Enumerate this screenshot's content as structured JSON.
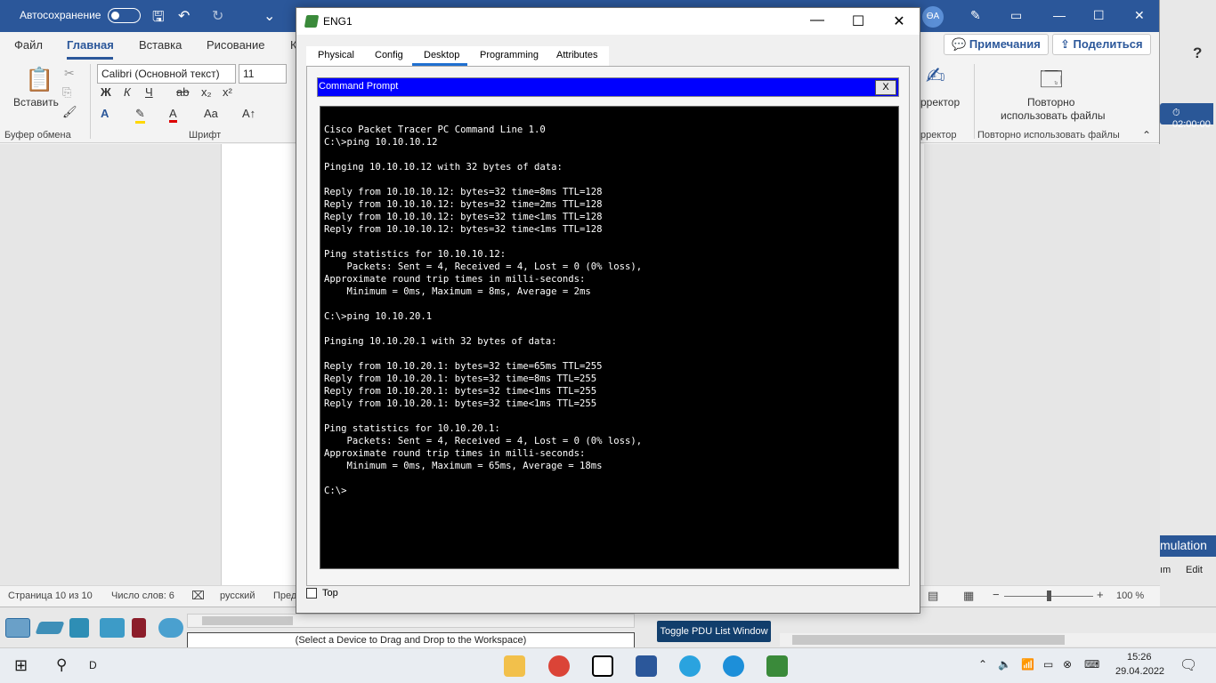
{
  "word": {
    "title_bar": {
      "autosave_label": "Автосохранение",
      "user_initials": "ӨА"
    },
    "menu": [
      "Файл",
      "Главная",
      "Вставка",
      "Рисование",
      "К"
    ],
    "notes_button": "Примечания",
    "share_button": "Поделиться",
    "help": "?",
    "ribbon": {
      "paste_label": "Вставить",
      "clipboard_group": "Буфер обмена",
      "font_name": "Calibri (Основной текст)",
      "font_size": "11",
      "bold": "Ж",
      "italic": "К",
      "underline": "Ч",
      "strike": "ab",
      "subscript": "x₂",
      "superscript": "x²",
      "font_group": "Шрифт",
      "case": "Aa",
      "grow": "A↑",
      "editor_label": "рректор",
      "editor_group": "рректор",
      "reuse_label_1": "Повторно",
      "reuse_label_2": "использовать файлы",
      "reuse_group": "Повторно использовать файлы"
    },
    "status": {
      "page": "Страница 10 из 10",
      "words": "Число слов: 6",
      "language": "русский",
      "cut": "Пред",
      "zoom": "100 %",
      "zoom_minus": "−",
      "zoom_plus": "+"
    }
  },
  "pt": {
    "timer": "02:00:00",
    "simulation": "mulation",
    "um": "ım",
    "edit": "Edit",
    "device_hint": "(Select a Device to Drag and Drop to the Workspace)",
    "toggle_pdu": "Toggle PDU List Window"
  },
  "eng1": {
    "title": "ENG1",
    "tabs": [
      "Physical",
      "Config",
      "Desktop",
      "Programming",
      "Attributes"
    ],
    "active_tab": "Desktop",
    "cmd_title": "Command Prompt",
    "cmd_close": "X",
    "top_label": "Top",
    "terminal_lines": [
      "Cisco Packet Tracer PC Command Line 1.0",
      "C:\\>ping 10.10.10.12",
      "",
      "Pinging 10.10.10.12 with 32 bytes of data:",
      "",
      "Reply from 10.10.10.12: bytes=32 time=8ms TTL=128",
      "Reply from 10.10.10.12: bytes=32 time=2ms TTL=128",
      "Reply from 10.10.10.12: bytes=32 time<1ms TTL=128",
      "Reply from 10.10.10.12: bytes=32 time<1ms TTL=128",
      "",
      "Ping statistics for 10.10.10.12:",
      "    Packets: Sent = 4, Received = 4, Lost = 0 (0% loss),",
      "Approximate round trip times in milli-seconds:",
      "    Minimum = 0ms, Maximum = 8ms, Average = 2ms",
      "",
      "C:\\>ping 10.10.20.1",
      "",
      "Pinging 10.10.20.1 with 32 bytes of data:",
      "",
      "Reply from 10.10.20.1: bytes=32 time=65ms TTL=255",
      "Reply from 10.10.20.1: bytes=32 time=8ms TTL=255",
      "Reply from 10.10.20.1: bytes=32 time<1ms TTL=255",
      "Reply from 10.10.20.1: bytes=32 time<1ms TTL=255",
      "",
      "Ping statistics for 10.10.20.1:",
      "    Packets: Sent = 4, Received = 4, Lost = 0 (0% loss),",
      "Approximate round trip times in milli-seconds:",
      "    Minimum = 0ms, Maximum = 65ms, Average = 18ms",
      "",
      "C:\\>"
    ]
  },
  "taskbar": {
    "search_text": "D",
    "time": "15:26",
    "date": "29.04.2022"
  }
}
